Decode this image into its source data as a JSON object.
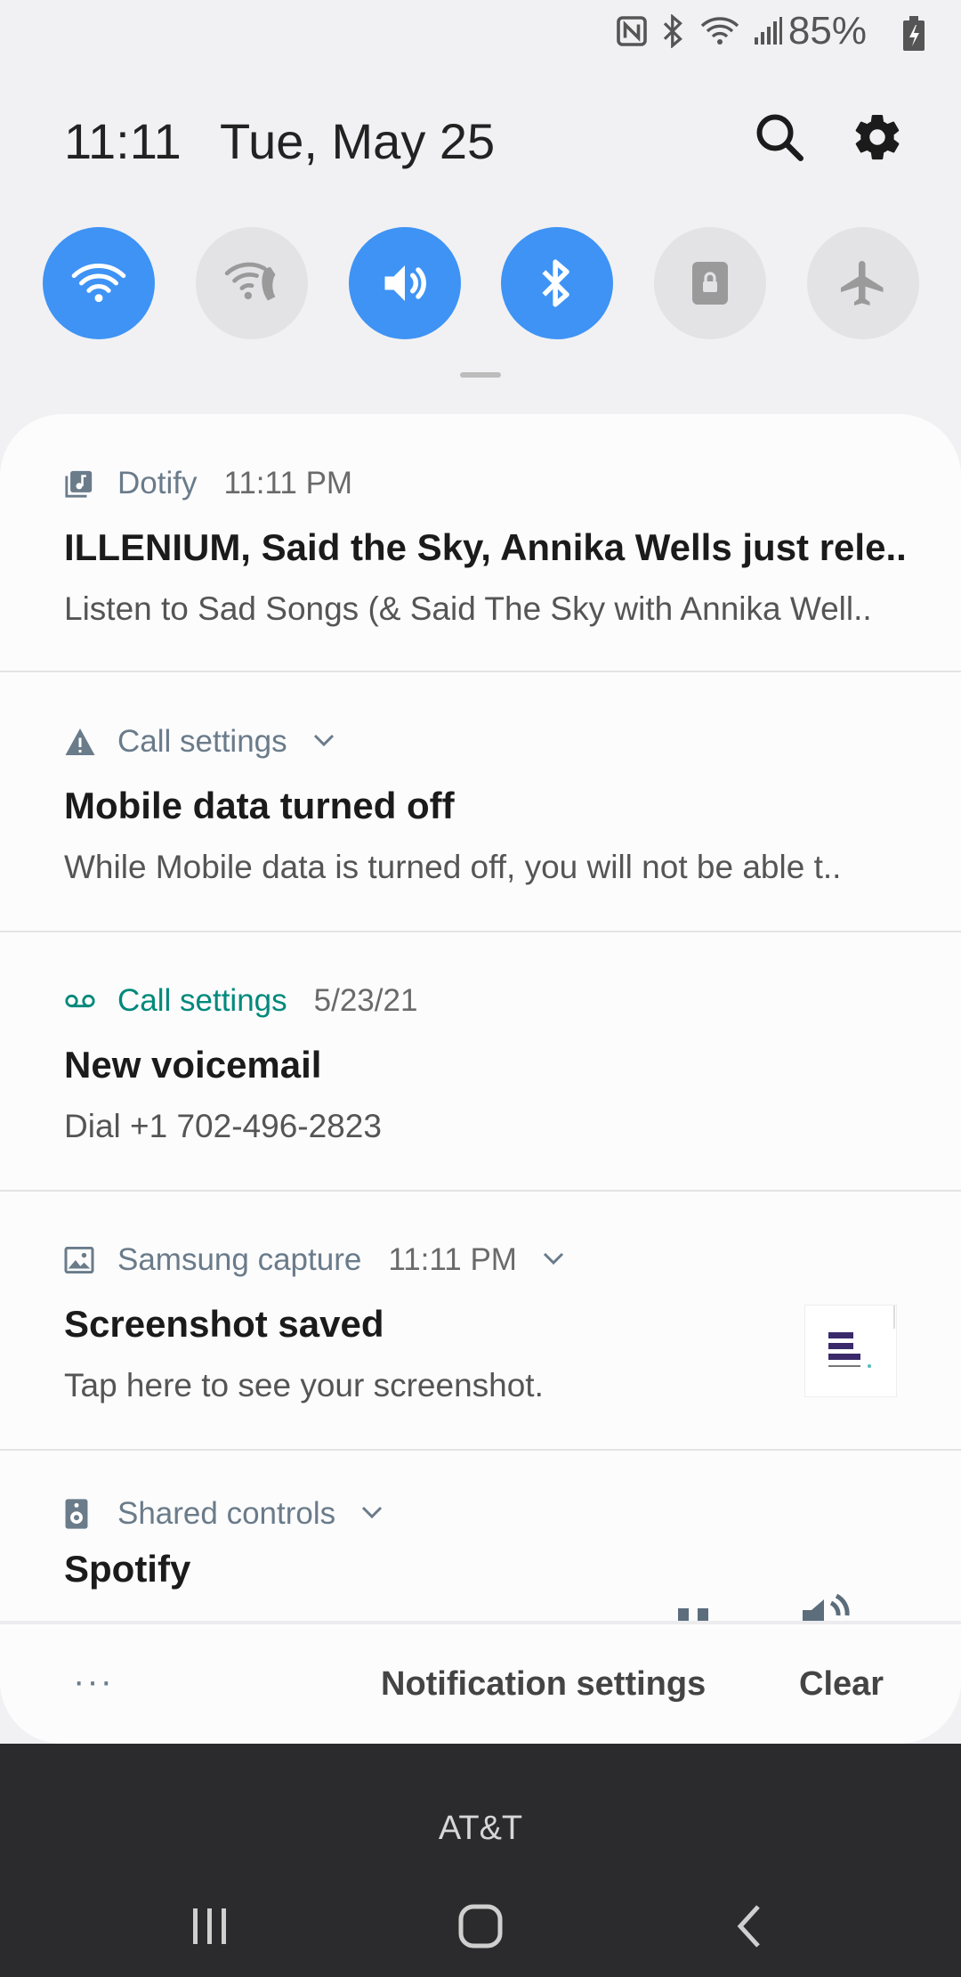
{
  "status_bar": {
    "battery": "85%",
    "icons": [
      "nfc-icon",
      "bluetooth-icon",
      "wifi-icon",
      "signal-icon",
      "battery-charging-icon"
    ]
  },
  "header": {
    "time": "11:11",
    "date": "Tue, May 25"
  },
  "quick_settings": [
    {
      "name": "wifi",
      "icon": "wifi-icon",
      "state": "on"
    },
    {
      "name": "wifi-calling",
      "icon": "wifi-calling-icon",
      "state": "off"
    },
    {
      "name": "sound",
      "icon": "volume-icon",
      "state": "on"
    },
    {
      "name": "bluetooth",
      "icon": "bluetooth-icon",
      "state": "on"
    },
    {
      "name": "portrait-lock",
      "icon": "rotation-lock-icon",
      "state": "off"
    },
    {
      "name": "airplane-mode",
      "icon": "airplane-icon",
      "state": "off"
    }
  ],
  "notifications": [
    {
      "app": "Dotify",
      "time": "11:11 PM",
      "title": "ILLENIUM, Said the Sky, Annika Wells just rele..",
      "body": "Listen to Sad Songs (& Said The Sky with Annika Well.."
    },
    {
      "app": "Call settings",
      "title": "Mobile data turned off",
      "body": "While Mobile data is turned off, you will not be able t.."
    },
    {
      "app": "Call settings",
      "time": "5/23/21",
      "title": "New voicemail",
      "body": "Dial +1 702-496-2823"
    },
    {
      "app": "Samsung capture",
      "time": "11:11 PM",
      "title": "Screenshot saved",
      "body": "Tap here to see your screenshot."
    },
    {
      "app": "Shared controls",
      "title": "Spotify"
    }
  ],
  "footer": {
    "more": "···",
    "notification_settings": "Notification settings",
    "clear": "Clear"
  },
  "carrier": "AT&T",
  "colors": {
    "accent": "#3e93f5",
    "teal": "#00897b",
    "panel": "#fcfcfd",
    "background": "#f1f1f3",
    "navbar": "#2b2b2d"
  }
}
